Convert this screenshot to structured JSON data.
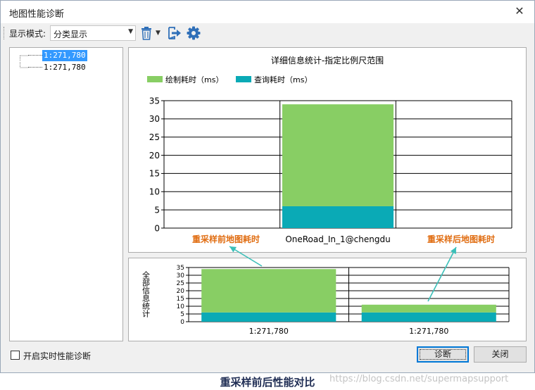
{
  "window": {
    "title": "地图性能诊断"
  },
  "toolbar": {
    "mode_label": "显示模式:",
    "mode_value": "分类显示"
  },
  "tree": {
    "items": [
      {
        "label": "1:271,780",
        "selected": true
      },
      {
        "label": "1:271,780",
        "selected": false
      }
    ]
  },
  "footer": {
    "realtime_label": "开启实时性能诊断",
    "diagnose_label": "诊断",
    "close_label": "关闭"
  },
  "caption": "重采样前后性能对比",
  "watermark": "https://blog.csdn.net/supermapsupport",
  "colors": {
    "draw": "#88ce64",
    "query": "#0aaab6",
    "annotation": "#e06c10",
    "arrow": "#3bbfb8"
  },
  "chart_data": [
    {
      "type": "bar",
      "stacked": true,
      "title": "详细信息统计-指定比例尺范围",
      "categories": [
        "",
        "OneRoad_In_1@chengdu",
        ""
      ],
      "series": [
        {
          "name": "查询耗时（ms）",
          "values": [
            0,
            6,
            0
          ]
        },
        {
          "name": "绘制耗时（ms）",
          "values": [
            0,
            28,
            0
          ]
        }
      ],
      "ylim": [
        0,
        35
      ],
      "yticks": [
        0,
        5,
        10,
        15,
        20,
        25,
        30,
        35
      ],
      "grid": true,
      "legend": "top-left",
      "annotations": [
        "重采样前地图耗时",
        "重采样后地图耗时"
      ]
    },
    {
      "type": "bar",
      "stacked": true,
      "categories": [
        "1:271,780",
        "1:271,780"
      ],
      "series": [
        {
          "name": "查询耗时（ms）",
          "values": [
            6,
            6
          ]
        },
        {
          "name": "绘制耗时（ms）",
          "values": [
            28,
            5
          ]
        }
      ],
      "ylabel": "全部信息统计",
      "ylim": [
        0,
        35
      ],
      "yticks": [
        0,
        5,
        10,
        15,
        20,
        25,
        30,
        35
      ],
      "grid": true
    }
  ]
}
